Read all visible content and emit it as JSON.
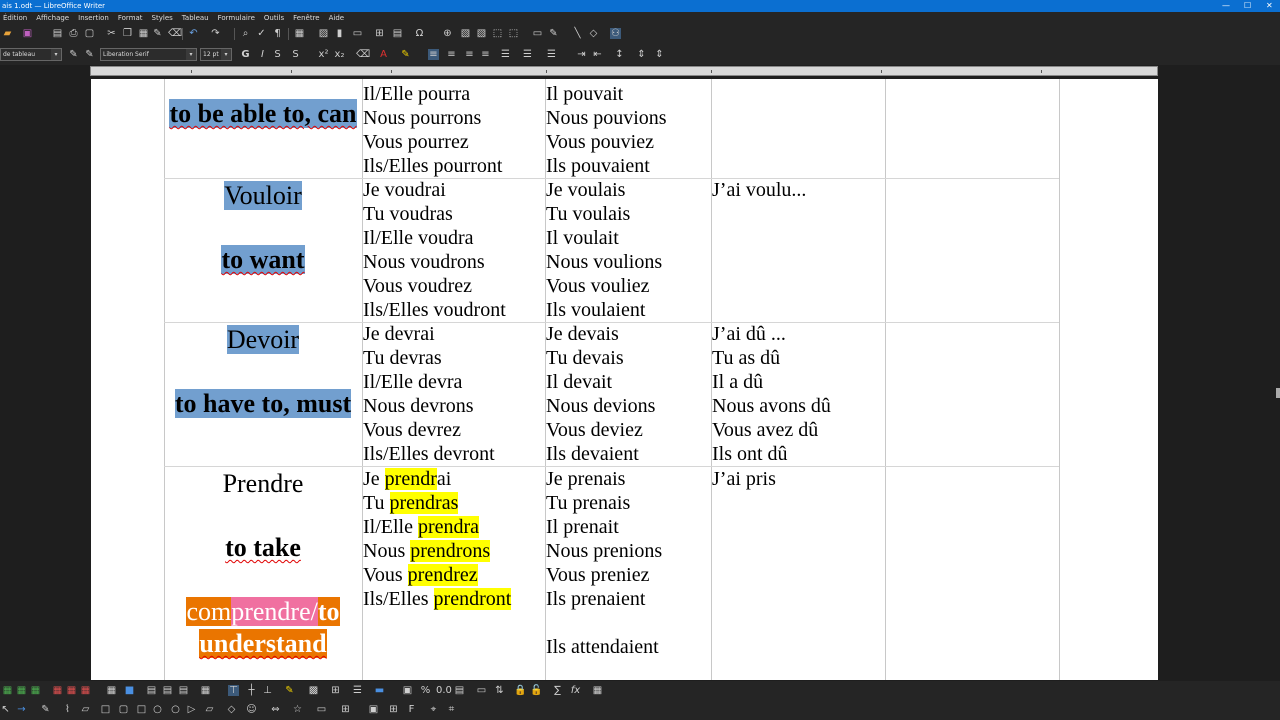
{
  "window": {
    "title": "ais 1.odt — LibreOffice Writer"
  },
  "menu": [
    "Édition",
    "Affichage",
    "Insertion",
    "Format",
    "Styles",
    "Tableau",
    "Formulaire",
    "Outils",
    "Fenêtre",
    "Aide"
  ],
  "formatting": {
    "paragraph_style": "de tableau",
    "font_name": "Liberation Serif",
    "font_size": "12 pt"
  },
  "table": {
    "rows": [
      {
        "verb_fr": "",
        "verb_en": "to be able to, can",
        "future": [
          "Il/Elle pourra",
          "Nous pourrons",
          "Vous pourrez",
          "Ils/Elles pourront"
        ],
        "imperfect": [
          "Il pouvait",
          "Nous pouvions",
          "Vous pouviez",
          "Ils pouvaient"
        ],
        "passe": []
      },
      {
        "verb_fr": "Vouloir",
        "verb_en": "to want",
        "future": [
          "Je voudrai",
          "Tu voudras",
          "Il/Elle voudra",
          "Nous voudrons",
          "Vous voudrez",
          "Ils/Elles voudront"
        ],
        "imperfect": [
          "Je voulais",
          "Tu voulais",
          "Il voulait",
          "Nous voulions",
          "Vous vouliez",
          "Ils voulaient"
        ],
        "passe": [
          "J’ai voulu..."
        ]
      },
      {
        "verb_fr": "Devoir",
        "verb_en": "to have to, must",
        "future": [
          "Je devrai",
          "Tu devras",
          "Il/Elle devra",
          "Nous devrons",
          "Vous devrez",
          "Ils/Elles devront"
        ],
        "imperfect": [
          "Je devais",
          "Tu devais",
          "Il devait",
          "Nous devions",
          "Vous deviez",
          "Ils devaient"
        ],
        "passe": [
          "J’ai dû ...",
          "Tu as dû",
          "Il a dû",
          "Nous avons dû",
          "Vous avez dû",
          "Ils ont dû"
        ]
      },
      {
        "verb_fr": "Prendre",
        "verb_en": "to take",
        "extra_prefix": "com",
        "extra_mid": "prendre/",
        "extra_to": "to",
        "extra_en": "understand",
        "future_pronouns": [
          "Je ",
          "Tu ",
          "Il/Elle ",
          "Nous ",
          "Vous ",
          "Ils/Elles "
        ],
        "future_stems": [
          "prendr",
          "prendras",
          "prendra",
          "prendrons",
          "prendrez",
          "prendront"
        ],
        "future_tail_0": "ai",
        "imperfect": [
          "Je prenais",
          "Tu prenais",
          "Il prenait",
          "Nous prenions",
          "Vous preniez",
          "Ils prenaient",
          "",
          "Ils attendaient"
        ],
        "passe": [
          "J’ai pris"
        ]
      }
    ]
  },
  "colors": {
    "titlebar": "#0b6fd1",
    "highlight_blue": "#729fcf",
    "highlight_yellow": "#ffff00",
    "highlight_orange": "#ea7500",
    "highlight_pink": "#f070a0"
  }
}
